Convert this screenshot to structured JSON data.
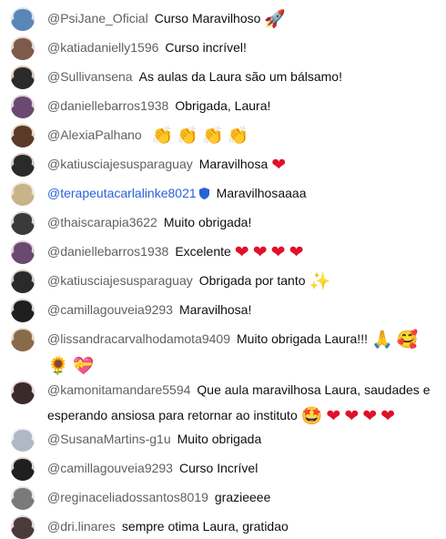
{
  "messages": [
    {
      "author": "@PsiJane_Oficial",
      "text": "Curso Maravilhoso",
      "emojis": [
        "🚀"
      ],
      "avatar_color": "#5a86b8"
    },
    {
      "author": "@katiadanielly1596",
      "text": "Curso incrível!",
      "emojis": [],
      "avatar_color": "#7d5a4a"
    },
    {
      "author": "@Sullivansena",
      "text": "As aulas da Laura são um bálsamo!",
      "emojis": [],
      "avatar_color": "#2b2b2b"
    },
    {
      "author": "@daniellebarros1938",
      "text": "Obrigada, Laura!",
      "emojis": [],
      "avatar_color": "#6a4a70"
    },
    {
      "author": "@AlexiaPalhano",
      "text": "",
      "emojis": [
        "👏",
        "👏",
        "👏",
        "👏"
      ],
      "avatar_color": "#5b3a2a"
    },
    {
      "author": "@katiusciajesusparaguay",
      "text": "Maravilhosa",
      "emojis": [
        "❤"
      ],
      "avatar_color": "#2a2a2a"
    },
    {
      "author": "@terapeutacarlalinke8021",
      "text": "Maravilhosaaaa",
      "emojis": [],
      "avatar_color": "#c9b48a",
      "owner": true
    },
    {
      "author": "@thaiscarapia3622",
      "text": "Muito obrigada!",
      "emojis": [],
      "avatar_color": "#3a3a3a"
    },
    {
      "author": "@daniellebarros1938",
      "text": "Excelente",
      "emojis": [
        "❤",
        "❤",
        "❤",
        "❤"
      ],
      "avatar_color": "#6a4a70"
    },
    {
      "author": "@katiusciajesusparaguay",
      "text": "Obrigada por tanto",
      "emojis": [
        "✨"
      ],
      "avatar_color": "#2a2a2a"
    },
    {
      "author": "@camillagouveia9293",
      "text": "Maravilhosa!",
      "emojis": [],
      "avatar_color": "#1f1f1f"
    },
    {
      "author": "@lissandracarvalhodamota9409",
      "text": "Muito obrigada Laura!!!",
      "emojis": [
        "🙏",
        "🥰",
        "🌻",
        "💝"
      ],
      "avatar_color": "#8a6a4a"
    },
    {
      "author": "@kamonitamandare5594",
      "text": "Que aula maravilhosa Laura, saudades e esperando ansiosa para retornar ao instituto",
      "emojis": [
        "🤩",
        "❤",
        "❤",
        "❤",
        "❤"
      ],
      "avatar_color": "#3a2a2a"
    },
    {
      "author": "@SusanaMartins-g1u",
      "text": "Muito obrigada",
      "emojis": [],
      "avatar_color": "#b0b8c8"
    },
    {
      "author": "@camillagouveia9293",
      "text": "Curso Incrível",
      "emojis": [],
      "avatar_color": "#1f1f1f"
    },
    {
      "author": "@reginaceliadossantos8019",
      "text": "grazieeee",
      "emojis": [],
      "avatar_color": "#7a7a7a"
    },
    {
      "author": "@dri.linares",
      "text": "sempre otima Laura, gratidao",
      "emojis": [],
      "avatar_color": "#4a3a3a"
    }
  ]
}
